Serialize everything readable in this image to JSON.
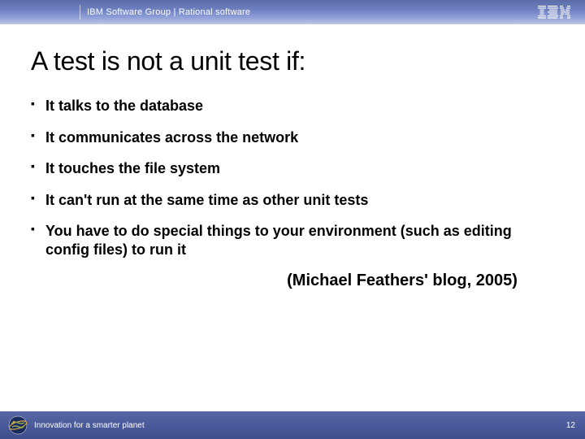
{
  "header": {
    "text": "IBM Software Group | Rational software",
    "logo": "IBM"
  },
  "title": "A test is not a unit test if:",
  "bullets": [
    "It talks to the database",
    "It communicates across the network",
    "It touches the file system",
    "It can't run at the same time as other unit tests",
    "You have to do special things to your environment (such as editing config files) to run it"
  ],
  "attribution": "(Michael Feathers' blog, 2005)",
  "footer": {
    "tagline": "Innovation for a smarter planet",
    "page": "12"
  }
}
